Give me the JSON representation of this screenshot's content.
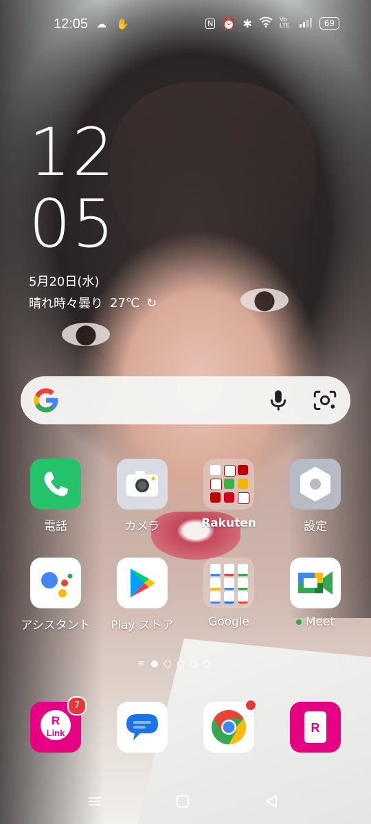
{
  "status_bar": {
    "time": "12:05",
    "left_icons": [
      "cloud-icon",
      "hand-icon"
    ],
    "right_icons": [
      "nfc-icon",
      "alarm-icon",
      "bluetooth-icon",
      "wifi-icon",
      "volte-icon",
      "signal-icon"
    ],
    "volte_label": "Vo LTE",
    "battery": "69"
  },
  "clock": {
    "hours": "12",
    "minutes": "05"
  },
  "date": "5月20日(水)",
  "weather": {
    "text": "晴れ時々曇り",
    "temp": "27℃"
  },
  "search": {
    "placeholder": ""
  },
  "apps": {
    "row1": [
      {
        "label": "電話",
        "icon": "phone-icon"
      },
      {
        "label": "カメラ",
        "icon": "camera-icon"
      },
      {
        "label": "Rakuten",
        "icon": "rakuten-folder-icon"
      },
      {
        "label": "設定",
        "icon": "settings-icon"
      }
    ],
    "row2": [
      {
        "label": "アシスタント",
        "icon": "assistant-icon"
      },
      {
        "label": "Play ストア",
        "icon": "play-store-icon"
      },
      {
        "label": "Google",
        "icon": "google-folder-icon"
      },
      {
        "label": "Meet",
        "icon": "meet-icon"
      }
    ]
  },
  "dock": [
    {
      "name": "Rakuten Link",
      "icon": "rakuten-link-icon",
      "badge": "7",
      "text": "Link"
    },
    {
      "name": "Messages",
      "icon": "messages-icon"
    },
    {
      "name": "Chrome",
      "icon": "chrome-icon"
    },
    {
      "name": "my 楽天モバイル",
      "icon": "rakuten-mobile-icon"
    }
  ],
  "pager": {
    "pages": 5,
    "current": 1
  },
  "colors": {
    "phone": "#24c26a",
    "rakuten": "#e60082",
    "google_blue": "#4285f4",
    "google_red": "#ea4335",
    "google_yellow": "#fbbc05",
    "google_green": "#34a853"
  }
}
